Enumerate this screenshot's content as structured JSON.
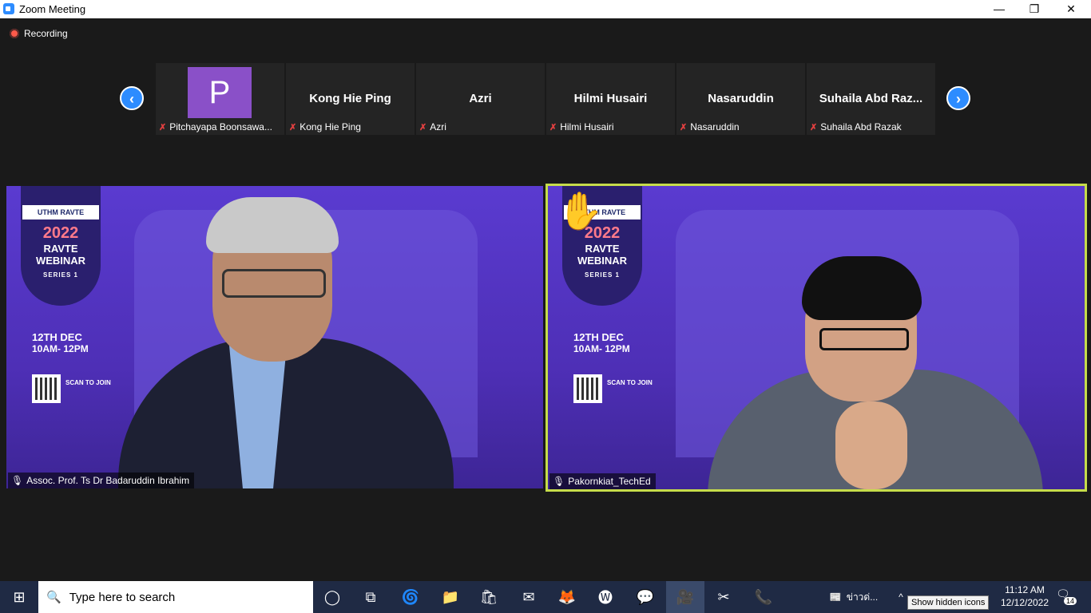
{
  "window": {
    "title": "Zoom Meeting"
  },
  "recording": {
    "label": "Recording"
  },
  "participants_strip": [
    {
      "display": "P",
      "label": "Pitchayapa Boonsawa..."
    },
    {
      "display": "Kong Hie Ping",
      "label": "Kong Hie Ping"
    },
    {
      "display": "Azri",
      "label": "Azri"
    },
    {
      "display": "Hilmi Husairi",
      "label": "Hilmi Husairi"
    },
    {
      "display": "Nasaruddin",
      "label": "Nasaruddin"
    },
    {
      "display": "Suhaila Abd Raz...",
      "label": "Suhaila Abd Razak"
    }
  ],
  "videos": [
    {
      "name": "Assoc. Prof. Ts Dr Badaruddin Ibrahim"
    },
    {
      "name": "Pakornkiat_TechEd"
    }
  ],
  "poster": {
    "logo": "UTHM RAVTE",
    "year": "2022",
    "line1": "RAVTE",
    "line2": "WEBINAR",
    "series": "SERIES 1",
    "date": "12TH DEC",
    "time": "10AM- 12PM",
    "scan": "SCAN TO JOIN"
  },
  "taskbar": {
    "search_placeholder": "Type here to search",
    "news": "ข่าวด่...",
    "time": "11:12 AM",
    "date": "12/12/2022",
    "notifications": "14",
    "tooltip": "Show hidden icons"
  },
  "colors": {
    "accent": "#2d8cff",
    "active_speaker_border": "#c6dc4a",
    "avatar_bg": "#8a50c8"
  }
}
